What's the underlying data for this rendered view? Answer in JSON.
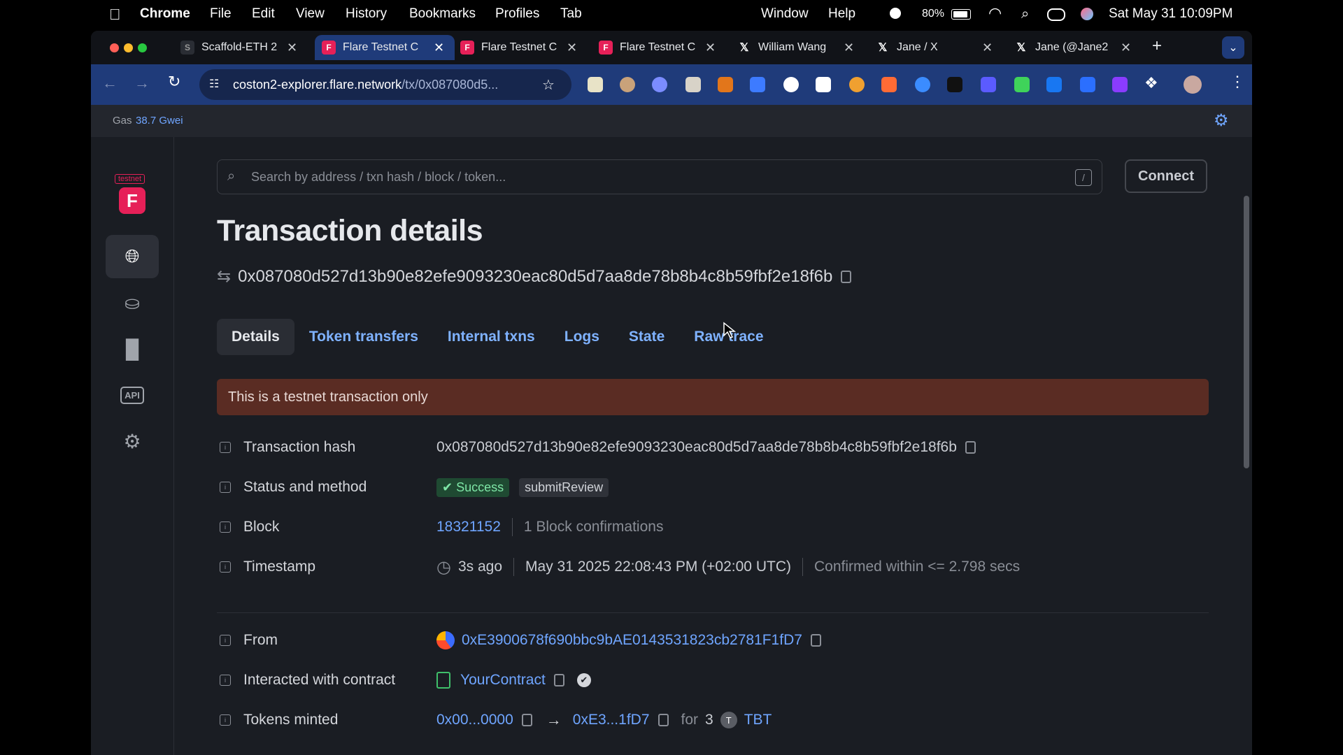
{
  "menubar": {
    "app": "Chrome",
    "items": [
      "File",
      "Edit",
      "View",
      "History",
      "Bookmarks",
      "Profiles",
      "Tab",
      "Window",
      "Help"
    ],
    "battery": "80%",
    "datetime": "Sat May 31  10:09PM"
  },
  "tabs": [
    {
      "title": "Scaffold-ETH 2",
      "icon": "scaffold-icon"
    },
    {
      "title": "Flare Testnet C",
      "icon": "flare-icon",
      "active": true
    },
    {
      "title": "Flare Testnet C",
      "icon": "flare-icon"
    },
    {
      "title": "Flare Testnet C",
      "icon": "flare-icon"
    },
    {
      "title": "William Wang",
      "icon": "x-icon"
    },
    {
      "title": "Jane / X",
      "icon": "x-icon"
    },
    {
      "title": "Jane (@Jane2",
      "icon": "x-icon"
    }
  ],
  "omnibox": {
    "host": "coston2-explorer.flare.network",
    "path": "/tx/0x087080d5..."
  },
  "gas": {
    "label": "Gas",
    "value": "38.7 Gwei"
  },
  "logo_badge": "testnet",
  "search": {
    "placeholder": "Search by address / txn hash / block / token...",
    "shortcut": "/"
  },
  "connect_label": "Connect",
  "page_title": "Transaction details",
  "tx_hash": "0x087080d527d13b90e82efe9093230eac80d5d7aa8de78b8b4c8b59fbf2e18f6b",
  "page_tabs": [
    "Details",
    "Token transfers",
    "Internal txns",
    "Logs",
    "State",
    "Raw trace"
  ],
  "alert": "This is a testnet transaction only",
  "details": {
    "hash_label": "Transaction hash",
    "hash_value": "0x087080d527d13b90e82efe9093230eac80d5d7aa8de78b8b4c8b59fbf2e18f6b",
    "status_label": "Status and method",
    "status": "Success",
    "method": "submitReview",
    "block_label": "Block",
    "block": "18321152",
    "confirmations": "1 Block confirmations",
    "timestamp_label": "Timestamp",
    "ago": "3s ago",
    "time": "May 31 2025 22:08:43 PM (+02:00 UTC)",
    "confirmed": "Confirmed within <= 2.798 secs",
    "from_label": "From",
    "from": "0xE3900678f690bbc9bAE0143531823cb2781F1fD7",
    "contract_label": "Interacted with contract",
    "contract": "YourContract",
    "minted_label": "Tokens minted",
    "minted_from": "0x00...0000",
    "minted_to": "0xE3...1fD7",
    "for_text": "for",
    "amount": "3",
    "token_letter": "T",
    "token": "TBT"
  },
  "colors": {
    "accent": "#6fa5ff",
    "tabbar": "#1f3b7a",
    "page": "#1a1d23",
    "alert": "#5a2c23",
    "success": "#7ee6a6"
  }
}
